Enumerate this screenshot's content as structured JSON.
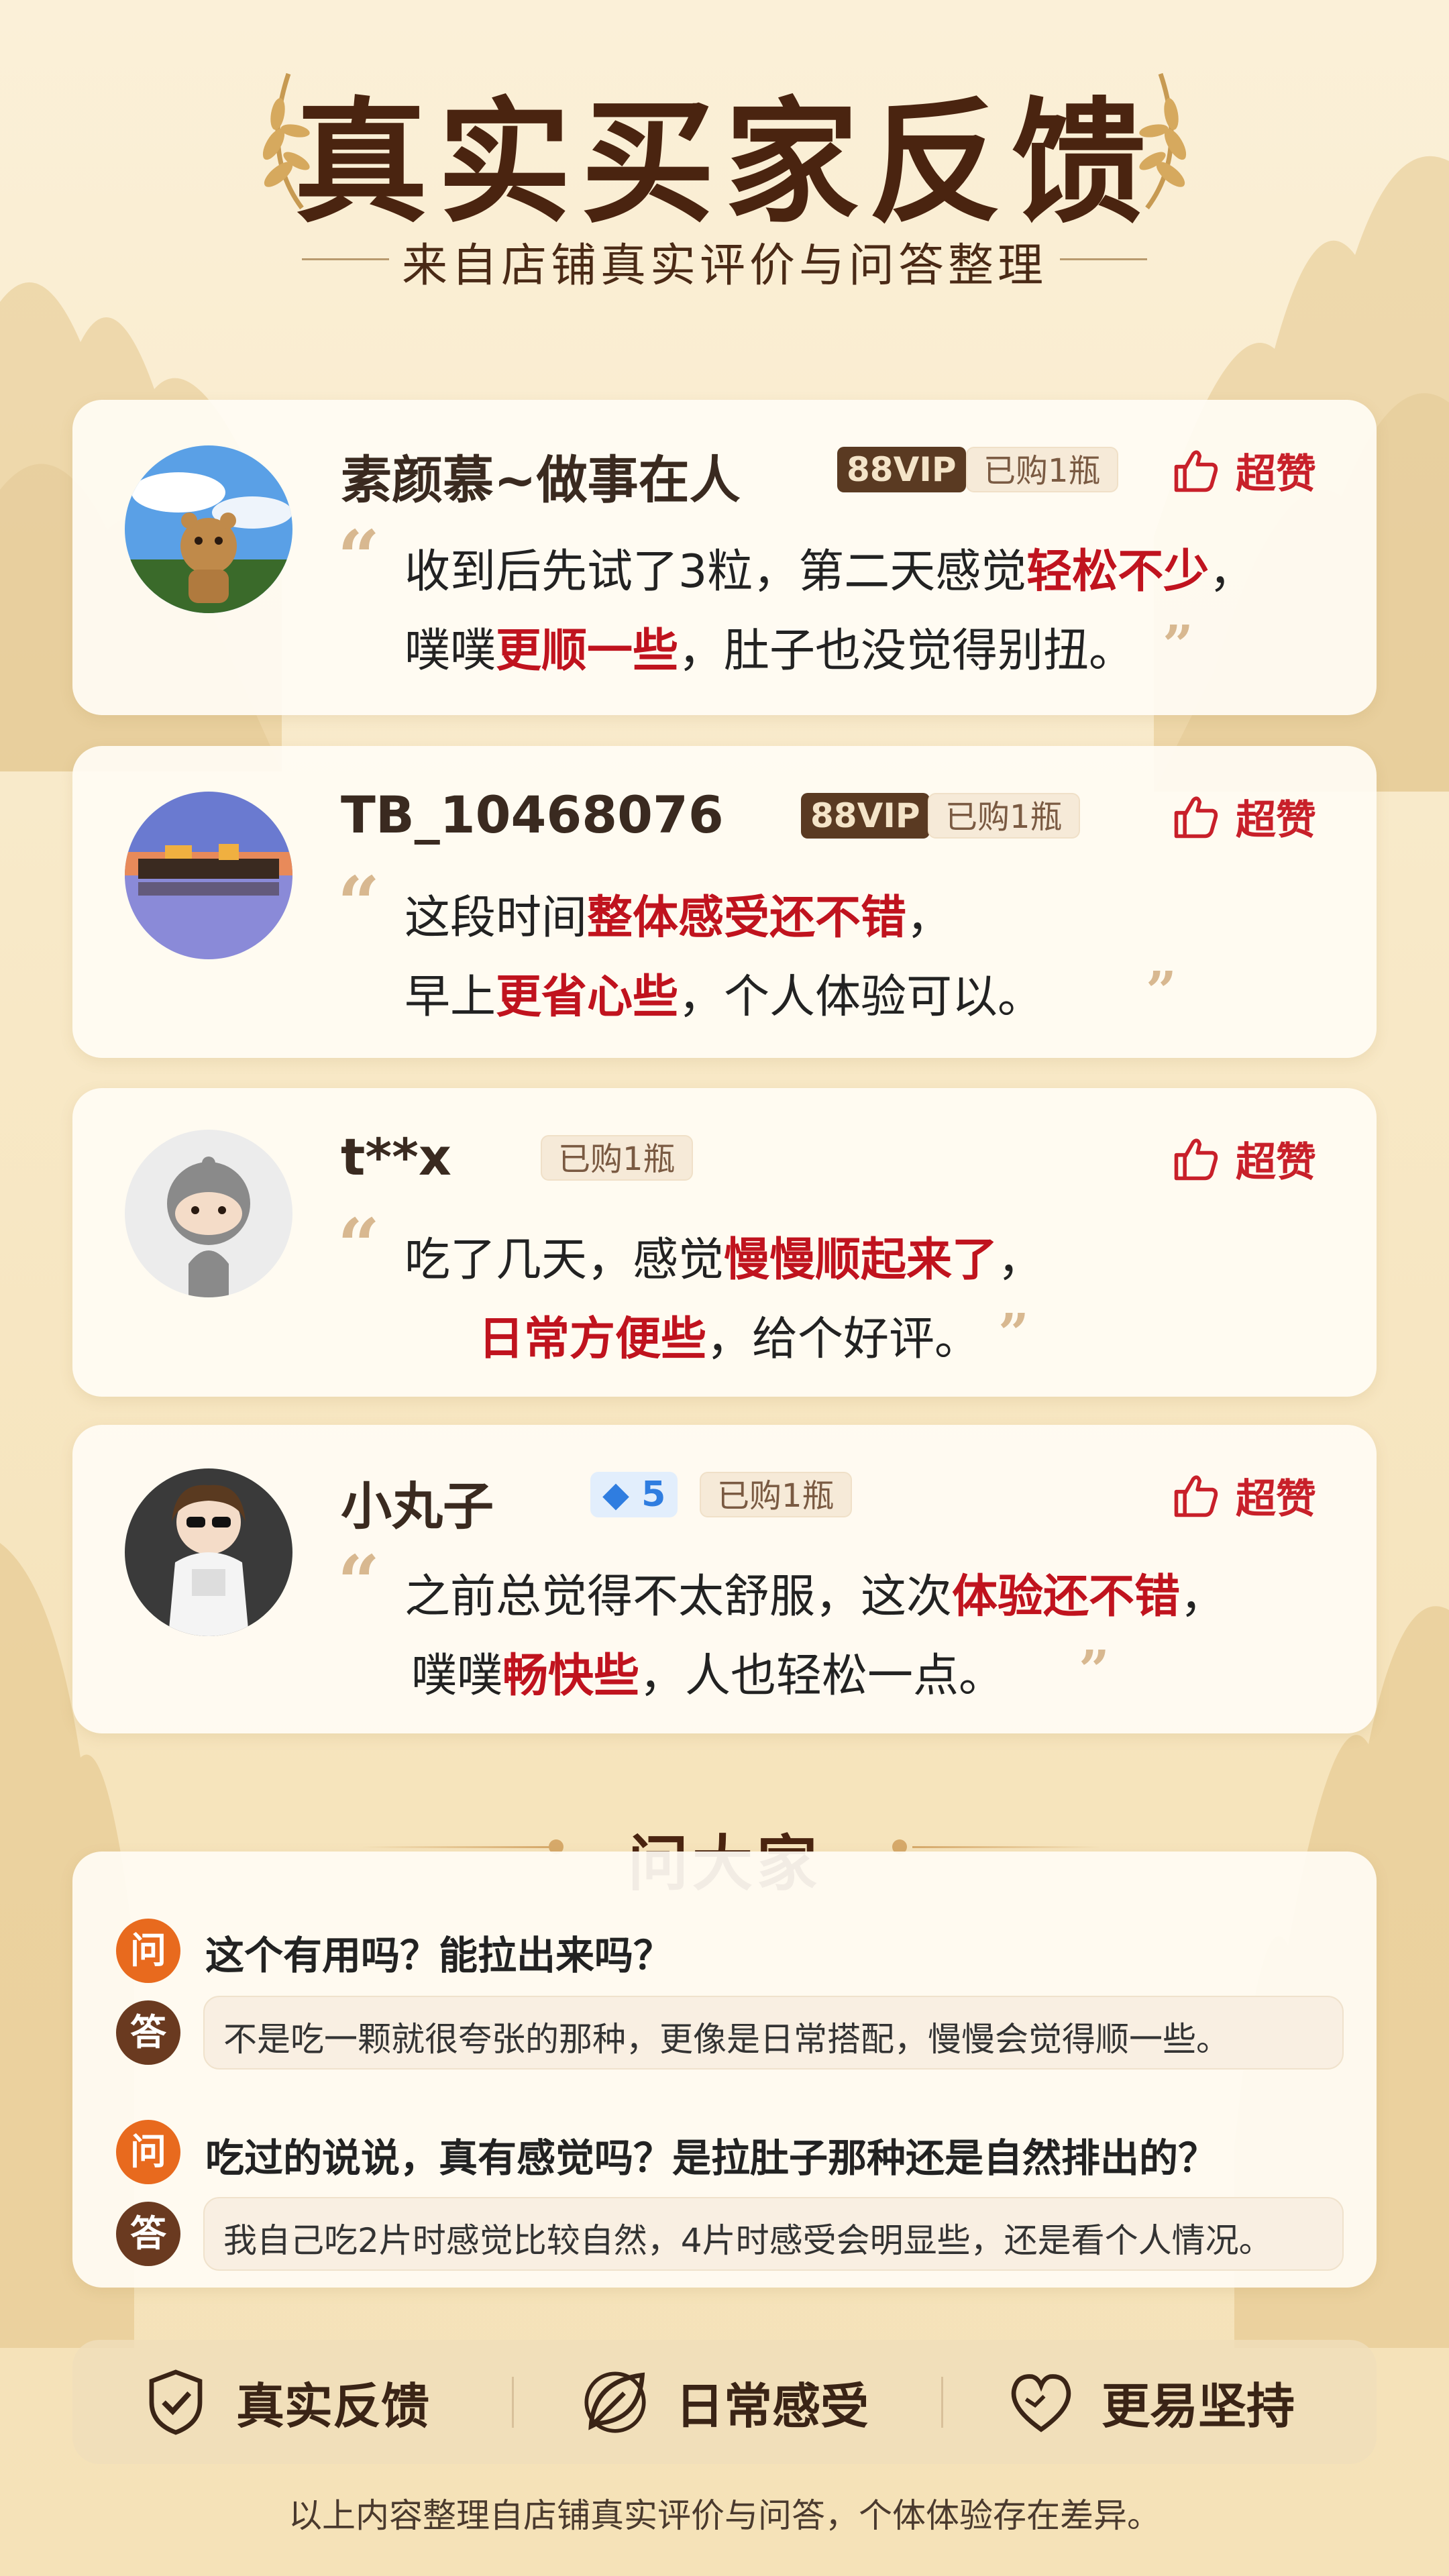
{
  "header": {
    "title": "真实买家反馈",
    "subtitle": "来自店铺真实评价与问答整理"
  },
  "reviews": [
    {
      "username": "素颜慕~做事在人",
      "vip": "88VIP",
      "bought": "已购1瓶",
      "like": "超赞",
      "line1": {
        "a": "收到后先试了3粒，第二天感觉",
        "h": "轻松不少",
        "b": "，"
      },
      "line2": {
        "a": "噗噗",
        "h": "更顺一些",
        "b": "，肚子也没觉得别扭。"
      }
    },
    {
      "username": "TB_10468076",
      "vip": "88VIP",
      "bought": "已购1瓶",
      "like": "超赞",
      "line1": {
        "a": "这段时间",
        "h": "整体感受还不错",
        "b": "，"
      },
      "line2": {
        "a": "早上",
        "h": "更省心些",
        "b": "，个人体验可以。"
      }
    },
    {
      "username": "t**x",
      "bought": "已购1瓶",
      "like": "超赞",
      "line1": {
        "a": "吃了几天，感觉",
        "h": "慢慢顺起来了",
        "b": "，"
      },
      "line2": {
        "a": "",
        "h": "日常方便些",
        "b": "，给个好评。"
      }
    },
    {
      "username": "小丸子",
      "level": "5",
      "bought": "已购1瓶",
      "like": "超赞",
      "line1": {
        "a": "之前总觉得不太舒服，这次",
        "h": "体验还不错",
        "b": "，"
      },
      "line2": {
        "a": "噗噗",
        "h": "畅快些",
        "b": "，人也轻松一点。"
      }
    }
  ],
  "ask": {
    "title": "问大家",
    "q_badge": "问",
    "a_badge": "答",
    "items": [
      {
        "q": "这个有用吗？能拉出来吗？",
        "a": "不是吃一颗就很夸张的那种，更像是日常搭配，慢慢会觉得顺一些。"
      },
      {
        "q": "吃过的说说，真有感觉吗？是拉肚子那种还是自然排出的？",
        "a": "我自己吃2片时感觉比较自然，4片时感受会明显些，还是看个人情况。"
      }
    ]
  },
  "features": [
    {
      "icon": "shield-check-icon",
      "label": "真实反馈"
    },
    {
      "icon": "leaf-icon",
      "label": "日常感受"
    },
    {
      "icon": "heart-icon",
      "label": "更易坚持"
    }
  ],
  "footer": "以上内容整理自店铺真实评价与问答，个体体验存在差异。",
  "colors": {
    "accent_red": "#c0131e",
    "brown": "#4a2410",
    "vip_bg": "#5a3a22",
    "gem_blue": "#2f7de0",
    "q_orange": "#e86a1e"
  }
}
